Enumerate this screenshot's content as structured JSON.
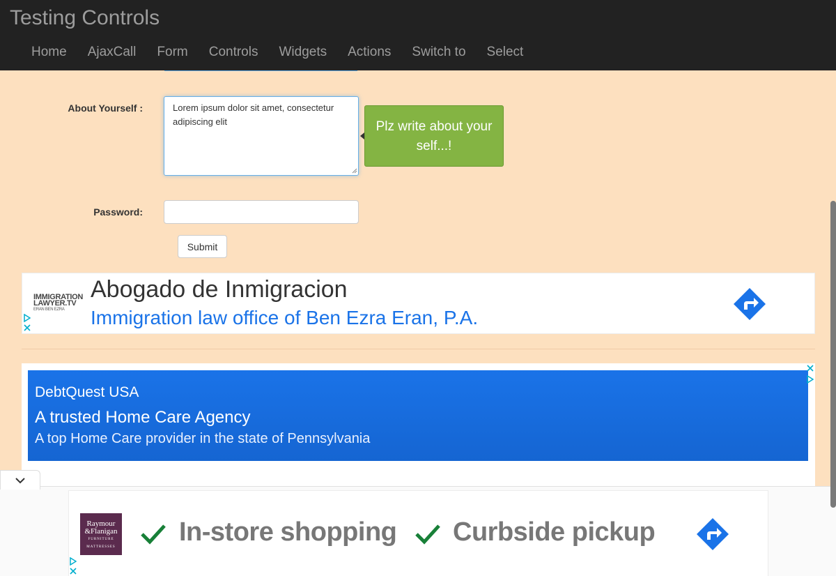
{
  "brand": "Testing Controls",
  "nav": [
    "Home",
    "AjaxCall",
    "Form",
    "Controls",
    "Widgets",
    "Actions",
    "Switch to",
    "Select"
  ],
  "form": {
    "about_label": "About Yourself :",
    "about_value": "Lorem ipsum dolor sit amet, consectetur adipiscing elit",
    "tooltip": "Plz write about your self...!",
    "password_label": "Password:",
    "password_value": "",
    "submit_label": "Submit"
  },
  "ads": {
    "ad1": {
      "logo_line1": "IMMIGRATION",
      "logo_line2": "LAWYER.TV",
      "logo_line3": "ERAN BEN EZRA",
      "title": "Abogado de Inmigracion",
      "subtitle": "Immigration law office of Ben Ezra Eran, P.A."
    },
    "ad2": {
      "advertiser": "DebtQuest USA",
      "title": "A trusted Home Care Agency",
      "description": "A top Home Care provider in the state of Pennsylvania"
    },
    "sticky": {
      "logo_line1": "Raymour",
      "logo_line2": "&Flanigan",
      "logo_line3": "FURNITURE",
      "logo_line4": "MATTRESSES",
      "feature1": "In-store shopping",
      "feature2": "Curbside pickup"
    }
  },
  "colors": {
    "navbar": "#222222",
    "page_bg": "#fde0bf",
    "tooltip_bg": "#84b443",
    "ad_link_blue": "#1a73e8",
    "check_green": "#188038"
  },
  "icons": [
    "adchoices-icon",
    "close-icon",
    "directions-icon",
    "check-icon",
    "chevron-down-icon"
  ]
}
